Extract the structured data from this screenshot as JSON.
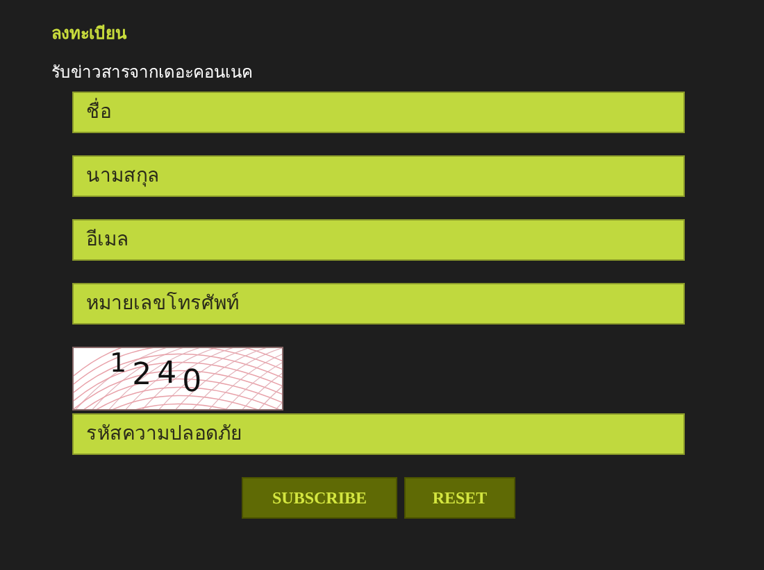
{
  "heading": "ลงทะเบียน",
  "subtitle": "รับข่าวสารจากเดอะคอนเนค",
  "fields": [
    {
      "placeholder": "ชื่อ"
    },
    {
      "placeholder": "นามสกุล"
    },
    {
      "placeholder": "อีเมล"
    },
    {
      "placeholder": "หมายเลขโทรศัพท์"
    }
  ],
  "captcha": {
    "code": "1240"
  },
  "security_field": {
    "placeholder": "รหัสความปลอดภัย"
  },
  "buttons": [
    {
      "label": "SUBSCRIBE"
    },
    {
      "label": "RESET"
    }
  ]
}
